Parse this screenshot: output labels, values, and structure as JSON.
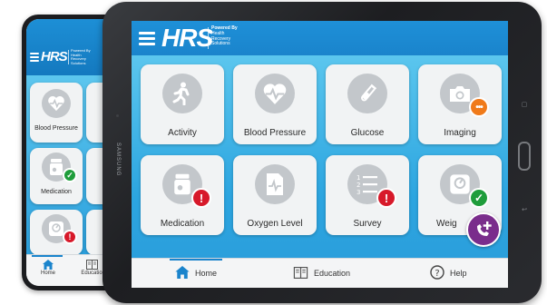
{
  "brand": {
    "logo_text": "HRS",
    "tagline_lines": [
      "Powered By",
      "Health",
      "Recovery",
      "Solutions"
    ]
  },
  "tablet": {
    "device_brand": "SAMSUNG",
    "tiles": [
      {
        "label": "Activity",
        "icon": "walking-person-icon",
        "badge": null
      },
      {
        "label": "Blood Pressure",
        "icon": "heart-pulse-icon",
        "badge": null
      },
      {
        "label": "Glucose",
        "icon": "test-tube-icon",
        "badge": null
      },
      {
        "label": "Imaging",
        "icon": "camera-icon",
        "badge": "more"
      },
      {
        "label": "Medication",
        "icon": "pill-bottle-icon",
        "badge": "alert"
      },
      {
        "label": "Oxygen Level",
        "icon": "pulse-document-icon",
        "badge": null
      },
      {
        "label": "Survey",
        "icon": "numbered-list-icon",
        "badge": "alert"
      },
      {
        "label": "Weight",
        "visible_label": "Weig",
        "icon": "scale-icon",
        "badge": "check"
      }
    ],
    "nav": [
      {
        "label": "Home",
        "icon": "home-icon",
        "active": true
      },
      {
        "label": "Education",
        "icon": "book-icon",
        "active": false
      },
      {
        "label": "Help",
        "icon": "help-icon",
        "active": false
      }
    ],
    "fab_icon": "add-call-icon"
  },
  "phone": {
    "tiles": [
      {
        "label": "Blood Pressure",
        "icon": "heart-pulse-icon",
        "badge": null
      },
      {
        "label": "Medication",
        "icon": "pill-bottle-icon",
        "badge": "check"
      },
      {
        "label": "",
        "icon": "scale-icon",
        "badge": "alert"
      }
    ],
    "nav": [
      {
        "label": "Home",
        "icon": "home-icon",
        "active": true
      },
      {
        "label": "Educatio",
        "icon": "book-icon",
        "active": false
      }
    ]
  },
  "colors": {
    "header_blue": "#1a84cc",
    "alert_red": "#d7192a",
    "check_green": "#1f9d3b",
    "more_orange": "#f07a1a",
    "fab_purple": "#7a2d8c"
  }
}
